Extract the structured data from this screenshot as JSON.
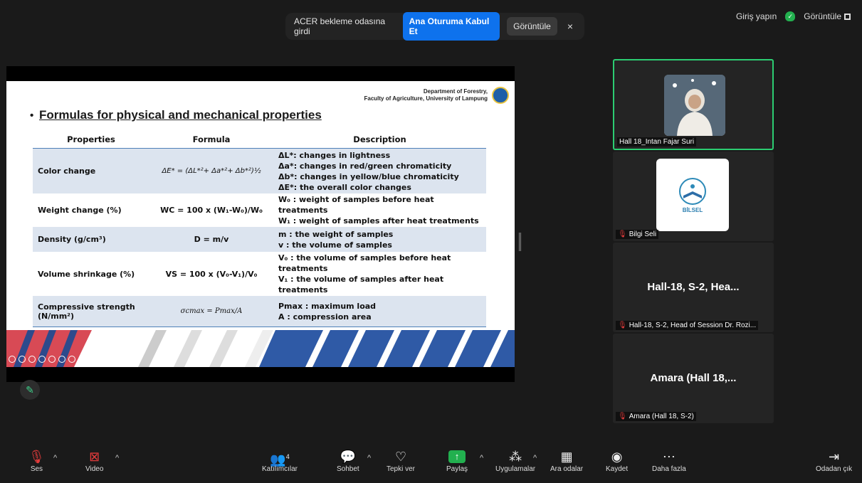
{
  "notification": {
    "text": "ACER bekleme odasına girdi",
    "primary_label": "Ana Oturuma Kabul Et",
    "secondary_label": "Görüntüle",
    "close": "×"
  },
  "topright": {
    "signin": "Giriş yapın",
    "view": "Görüntüle"
  },
  "slide": {
    "dept_line1": "Department of Forestry,",
    "dept_line2": "Faculty of Agriculture, University of Lampung",
    "title": "Formulas for physical and mechanical properties",
    "headers": [
      "Properties",
      "Formula",
      "Description"
    ],
    "rows": [
      {
        "property": "Color change",
        "formula": "ΔE* = (ΔL*²+ Δa*²+ Δb*²)½",
        "description": [
          "ΔL*: changes in lightness",
          "Δa*: changes in red/green  chromaticity",
          "Δb*: changes in yellow/blue chromaticity",
          "ΔE*: the overall color changes"
        ]
      },
      {
        "property": "Weight change (%)",
        "formula": "WC = 100 x (W₁-W₀)/W₀",
        "description": [
          "W₀ : weight of samples before heat treatments",
          "W₁ : weight of samples after heat treatments"
        ]
      },
      {
        "property": "Density (g/cm³)",
        "formula": "D = m/v",
        "description": [
          "m : the weight of samples",
          "v : the volume of samples"
        ]
      },
      {
        "property": "Volume shrinkage (%)",
        "formula": "VS = 100 x (V₀-V₁)/V₀",
        "description": [
          "V₀ : the volume of samples before heat treatments",
          "V₁ : the volume of samples after heat treatments"
        ]
      },
      {
        "property": "Compressive strength (N/mm²)",
        "formula": "σcmax = Pmax/A",
        "description": [
          "Pmax : maximum load",
          "A   : compression area"
        ]
      }
    ]
  },
  "participants": [
    {
      "name": "Hall 18_Intan Fajar Suri",
      "muted": false
    },
    {
      "name": "Bilgi Seli",
      "muted": true,
      "logo_text": "BİLSEL"
    },
    {
      "display": "Hall-18, S-2, Hea...",
      "name": "Hall-18, S-2, Head of Session Dr. Rozi...",
      "muted": true
    },
    {
      "display": "Amara (Hall 18,...",
      "name": "Amara (Hall 18, S-2)",
      "muted": true
    }
  ],
  "toolbar": {
    "audio": "Ses",
    "video": "Video",
    "participants": "Katılımcılar",
    "participant_count": "4",
    "chat": "Sohbet",
    "react": "Tepki ver",
    "share": "Paylaş",
    "apps": "Uygulamalar",
    "breakout": "Ara odalar",
    "record": "Kaydet",
    "more": "Daha fazla",
    "leave": "Odadan çık"
  },
  "colors": {
    "active_speaker": "#2ccd72",
    "primary_button": "#0e72ed",
    "share_green": "#22b04f",
    "muted_red": "#e23b3b"
  }
}
